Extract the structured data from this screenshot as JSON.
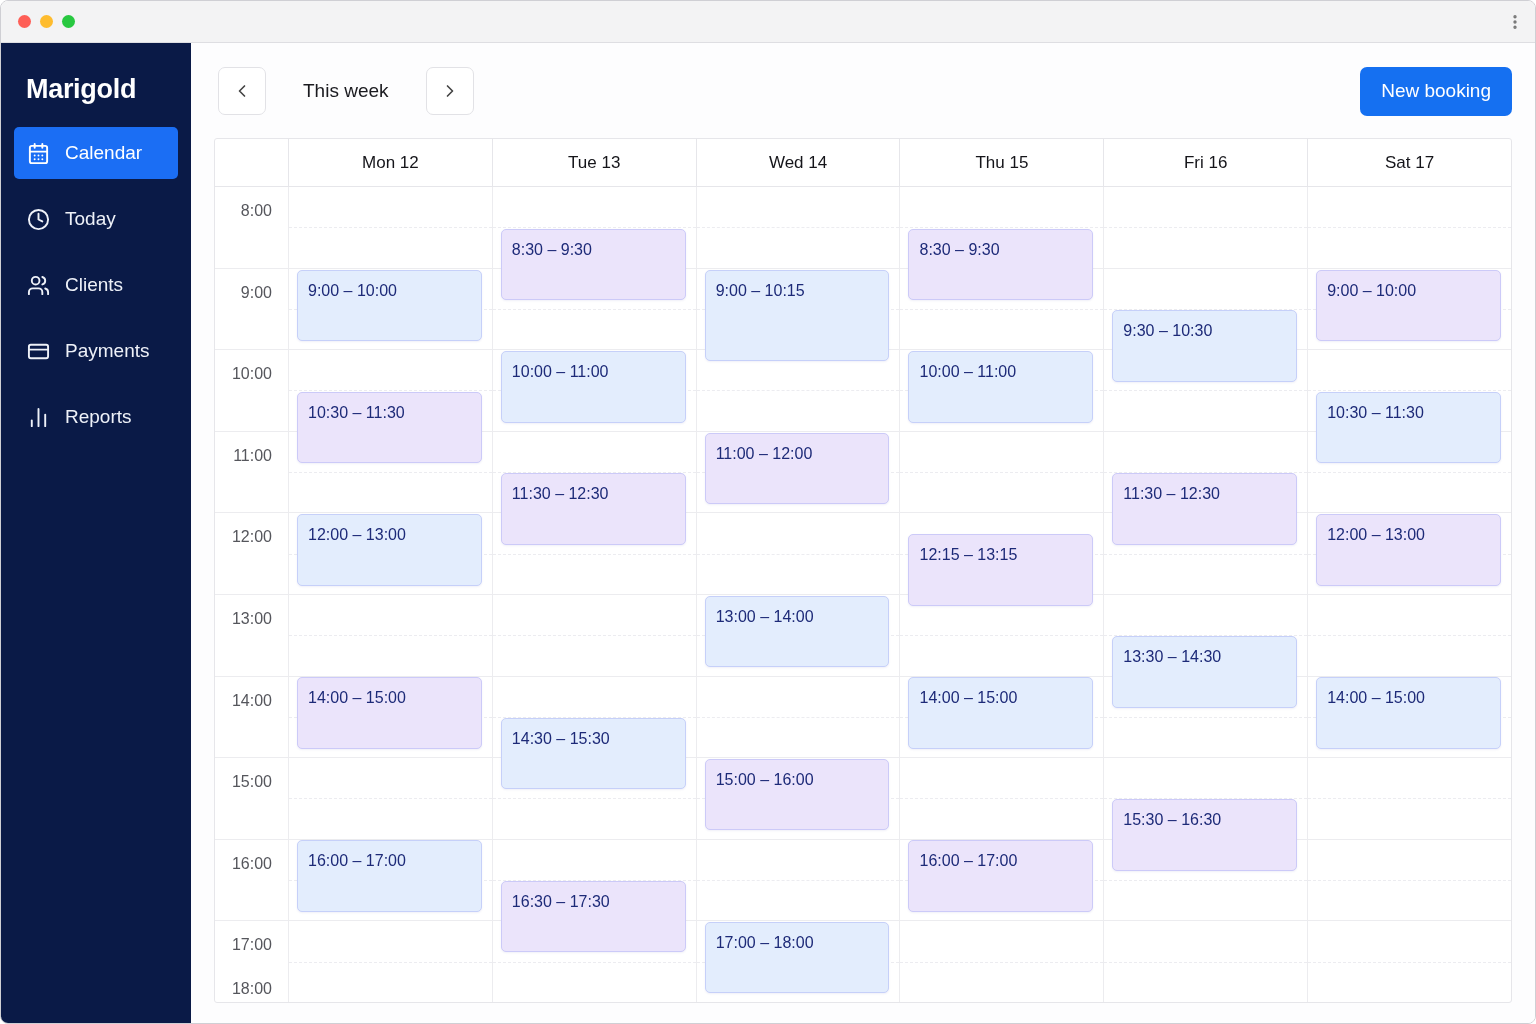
{
  "sidebar": {
    "logo": "Marigold",
    "items": [
      {
        "label": "Calendar",
        "selected": true
      },
      {
        "label": "Today",
        "selected": false
      },
      {
        "label": "Clients",
        "selected": false
      },
      {
        "label": "Payments",
        "selected": false
      },
      {
        "label": "Reports",
        "selected": false
      }
    ]
  },
  "toolbar": {
    "period": "This week",
    "new_button": "New booking"
  },
  "calendar": {
    "days": [
      {
        "label": "Mon 12",
        "events": [
          {
            "label": "9:00 – 10:00",
            "color": "#e3edfd"
          },
          {
            "label": "10:30 – 11:30",
            "color": "#ebe4fb"
          },
          {
            "label": "12:00 – 13:00",
            "color": "#e3edfd"
          },
          {
            "label": "14:00 – 15:00",
            "color": "#ebe4fb"
          },
          {
            "label": "16:00 – 17:00",
            "color": "#e3edfd"
          }
        ]
      },
      {
        "label": "Tue 13",
        "events": [
          {
            "label": "8:30 – 9:30",
            "color": "#ebe4fb"
          },
          {
            "label": "10:00 – 11:00",
            "color": "#e3edfd"
          },
          {
            "label": "11:30 – 12:30",
            "color": "#ebe4fb"
          },
          {
            "label": "14:30 – 15:30",
            "color": "#e3edfd"
          },
          {
            "label": "16:30 – 17:30",
            "color": "#ebe4fb"
          }
        ]
      },
      {
        "label": "Wed 14",
        "events": [
          {
            "label": "9:00 – 10:15",
            "color": "#e3edfd"
          },
          {
            "label": "11:00 – 12:00",
            "color": "#ebe4fb"
          },
          {
            "label": "13:00 – 14:00",
            "color": "#e3edfd"
          },
          {
            "label": "15:00 – 16:00",
            "color": "#ebe4fb"
          },
          {
            "label": "17:00 – 18:00",
            "color": "#e3edfd"
          }
        ]
      },
      {
        "label": "Thu 15",
        "events": [
          {
            "label": "8:30 – 9:30",
            "color": "#ebe4fb"
          },
          {
            "label": "10:00 – 11:00",
            "color": "#e3edfd"
          },
          {
            "label": "12:15 – 13:15",
            "color": "#ebe4fb"
          },
          {
            "label": "14:00 – 15:00",
            "color": "#e3edfd"
          },
          {
            "label": "16:00 – 17:00",
            "color": "#ebe4fb"
          }
        ]
      },
      {
        "label": "Fri 16",
        "events": [
          {
            "label": "9:30 – 10:30",
            "color": "#e3edfd"
          },
          {
            "label": "11:30 – 12:30",
            "color": "#ebe4fb"
          },
          {
            "label": "13:30 – 14:30",
            "color": "#e3edfd"
          },
          {
            "label": "15:30 – 16:30",
            "color": "#ebe4fb"
          }
        ]
      },
      {
        "label": "Sat 17",
        "events": [
          {
            "label": "9:00 – 10:00",
            "color": "#ebe4fb"
          },
          {
            "label": "10:30 – 11:30",
            "color": "#e3edfd"
          },
          {
            "label": "12:00 – 13:00",
            "color": "#ebe4fb"
          },
          {
            "label": "14:00 – 15:00",
            "color": "#e3edfd"
          }
        ]
      }
    ],
    "hours": [
      "8:00",
      "9:00",
      "10:00",
      "11:00",
      "12:00",
      "13:00",
      "14:00",
      "15:00",
      "16:00",
      "17:00",
      "18:00"
    ]
  }
}
